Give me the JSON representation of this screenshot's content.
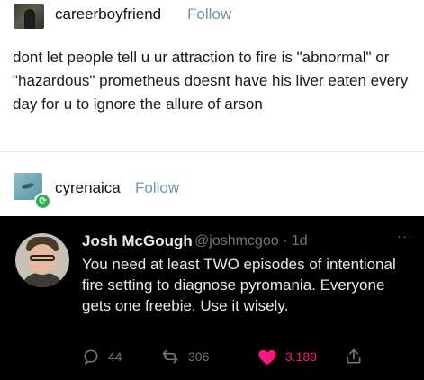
{
  "post": {
    "username": "careerboyfriend",
    "follow_label": "Follow",
    "body": "dont let people tell u ur attraction to fire is \"abnormal\" or \"hazardous\" prometheus doesnt have his liver eaten every day for u to ignore the allure of arson"
  },
  "reblog": {
    "username": "cyrenaica",
    "follow_label": "Follow"
  },
  "tweet": {
    "display_name": "Josh McGough",
    "handle_time": "@joshmcgoo · 1d",
    "more": "···",
    "text": "You need at least TWO episodes of intentional fire setting to diagnose pyromania. Everyone gets one freebie. Use it wisely.",
    "replies": "44",
    "retweets": "306",
    "likes": "3.189"
  },
  "colors": {
    "follow": "#6f97a8",
    "tweet_bg": "#000000",
    "like": "#f91880",
    "muted": "#71767b"
  },
  "icons": [
    "reply-icon",
    "retweet-icon",
    "heart-icon",
    "share-icon",
    "reblog-badge-icon"
  ]
}
